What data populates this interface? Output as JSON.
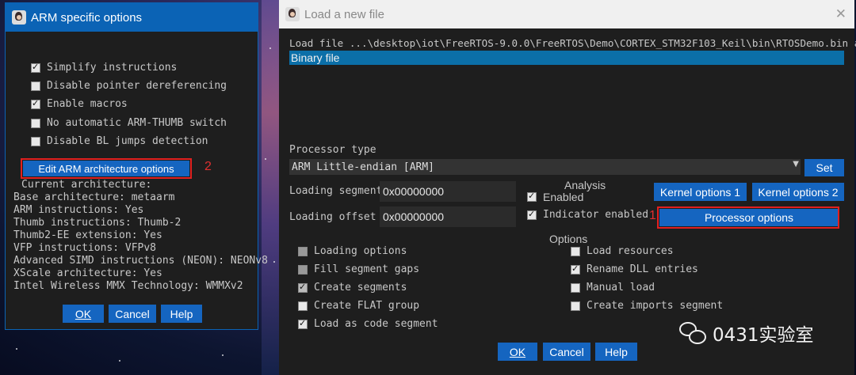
{
  "left_dialog": {
    "title": "ARM specific options",
    "checkboxes": [
      {
        "label": "Simplify instructions",
        "checked": true
      },
      {
        "label": "Disable pointer dereferencing",
        "checked": false
      },
      {
        "label": "Enable macros",
        "checked": true
      },
      {
        "label": "No automatic ARM-THUMB switch",
        "checked": false
      },
      {
        "label": "Disable BL jumps detection",
        "checked": false
      }
    ],
    "edit_arch_button": "Edit ARM architecture options",
    "edit_arch_marker": "2",
    "info_lines": [
      "Current architecture:",
      "Base architecture: metaarm",
      "ARM instructions: Yes",
      "Thumb instructions: Thumb-2",
      "Thumb2-EE extension: Yes",
      "VFP instructions: VFPv8",
      "Advanced SIMD instructions (NEON): NEONv8",
      "XScale architecture: Yes",
      "Intel Wireless MMX Technology: WMMXv2"
    ],
    "ok_label": "OK",
    "cancel_label": "Cancel",
    "help_label": "Help",
    "title_bar_color": "#0b63b5"
  },
  "right_dialog": {
    "title": "Load a new file",
    "load_file_line": "Load file ...\\desktop\\iot\\FreeRTOS-9.0.0\\FreeRTOS\\Demo\\CORTEX_STM32F103_Keil\\bin\\RTOSDemo.bin as",
    "file_type_selected": "Binary file",
    "processor_type_label": "Processor type",
    "processor_type_value": "ARM Little-endian [ARM]",
    "set_label": "Set",
    "loading_segment_label": "Loading segment",
    "loading_segment_value": "0x00000000",
    "loading_offset_label": "Loading offset",
    "loading_offset_value": "0x00000000",
    "analysis_title": "Analysis",
    "analysis_enabled_label": "Enabled",
    "analysis_indicator_label": "Indicator enabled",
    "kernel_options_1": "Kernel options 1",
    "kernel_options_2": "Kernel options 2",
    "processor_options": "Processor options",
    "processor_options_marker": "1",
    "options_title": "Options",
    "options_left": [
      {
        "label": "Loading options",
        "checked": false,
        "disabled": true
      },
      {
        "label": "Fill segment gaps",
        "checked": false,
        "disabled": true
      },
      {
        "label": "Create segments",
        "checked": true,
        "disabled": false
      },
      {
        "label": "Create FLAT group",
        "checked": false,
        "disabled": false
      },
      {
        "label": "Load as code segment",
        "checked": true,
        "disabled": false
      }
    ],
    "options_right": [
      {
        "label": "Load resources",
        "checked": false,
        "disabled": false
      },
      {
        "label": "Rename DLL entries",
        "checked": true,
        "disabled": false
      },
      {
        "label": "Manual load",
        "checked": false,
        "disabled": false
      },
      {
        "label": "Create imports segment",
        "checked": false,
        "disabled": false
      }
    ],
    "ok_label": "OK",
    "cancel_label": "Cancel",
    "help_label": "Help",
    "title_bar_color": "#f0f0f0"
  },
  "watermark": {
    "text": "0431实验室",
    "icon": "wechat-icon"
  },
  "colors": {
    "accent": "#1565c0",
    "highlight": "#0b6fa8",
    "annotation_red": "#e02020"
  }
}
